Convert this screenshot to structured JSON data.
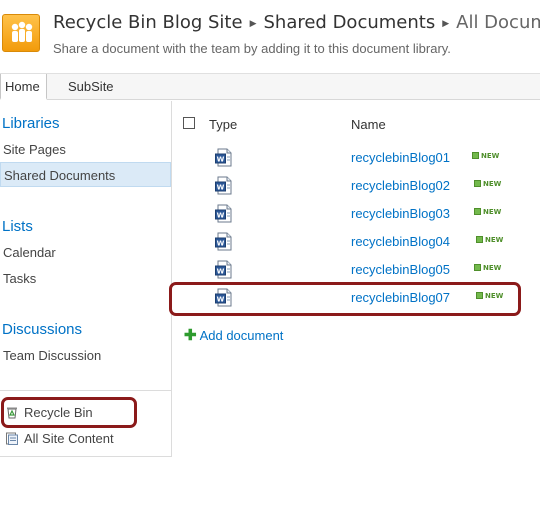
{
  "header": {
    "breadcrumb": [
      "Recycle Bin Blog Site",
      "Shared Documents",
      "All Docume"
    ],
    "description": "Share a document with the team by adding it to this document library."
  },
  "top_nav": {
    "tabs": [
      "Home",
      "SubSite"
    ]
  },
  "left_nav": {
    "libraries_heading": "Libraries",
    "libraries": [
      "Site Pages",
      "Shared Documents"
    ],
    "lists_heading": "Lists",
    "lists": [
      "Calendar",
      "Tasks"
    ],
    "discussions_heading": "Discussions",
    "discussions": [
      "Team Discussion"
    ],
    "recycle_bin": "Recycle Bin",
    "all_site_content": "All Site Content"
  },
  "doc_list": {
    "columns": {
      "type": "Type",
      "name": "Name"
    },
    "new_label": "NEW",
    "rows": [
      {
        "name": "recyclebinBlog01"
      },
      {
        "name": "recyclebinBlog02"
      },
      {
        "name": "recyclebinBlog03"
      },
      {
        "name": "recyclebinBlog04"
      },
      {
        "name": "recyclebinBlog05"
      },
      {
        "name": "recyclebinBlog07"
      }
    ],
    "add_document": "Add document"
  },
  "colors": {
    "accent": "#0072c6",
    "highlight": "#8b1a1a",
    "selected_bg": "#dbeaf7",
    "new_badge": "#4f8f2b"
  },
  "icons": [
    "site-logo-icon",
    "word-document-icon",
    "new-icon",
    "add-icon",
    "recycle-bin-icon",
    "all-site-content-icon"
  ]
}
